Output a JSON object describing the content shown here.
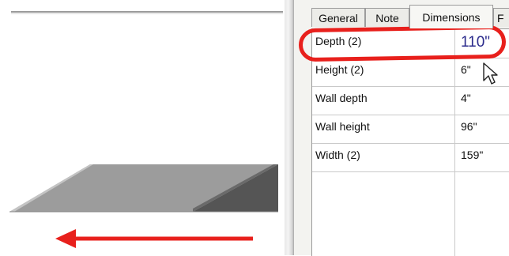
{
  "tabs": [
    {
      "label": "General"
    },
    {
      "label": "Note"
    },
    {
      "label": "Dimensions"
    },
    {
      "label": "F"
    }
  ],
  "properties": [
    {
      "label": "Depth (2)",
      "value": "110\""
    },
    {
      "label": "Height (2)",
      "value": "6\""
    },
    {
      "label": "Wall depth",
      "value": "4\""
    },
    {
      "label": "Wall height",
      "value": "96\""
    },
    {
      "label": "Width (2)",
      "value": "159\""
    }
  ],
  "colors": {
    "highlight": "#e8201c",
    "arrow": "#e8201c",
    "edited_value": "#2b2b8c"
  },
  "icons": [
    "mouse-pointer-icon",
    "left-arrow-icon"
  ]
}
